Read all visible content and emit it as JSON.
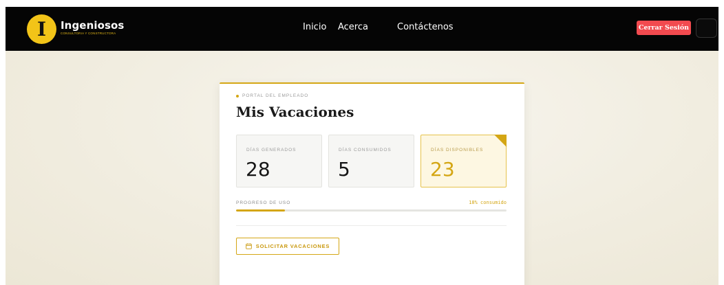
{
  "brand": {
    "name": "Ingeniosos",
    "subtitle": "CONSULTORIA Y CONSTRUCTORA",
    "logo_letter": "I",
    "accent_color": "#f2c418"
  },
  "nav": {
    "links": [
      {
        "label": "Inicio"
      },
      {
        "label": "Acerca"
      },
      {
        "label": "Contáctenos"
      }
    ],
    "logout_label": "Cerrar Sesión",
    "logout_color": "#f24a4f"
  },
  "portal": {
    "kicker": "PORTAL DEL EMPLEADO",
    "title": "Mis Vacaciones",
    "stats": [
      {
        "label": "DÍAS GENERADOS",
        "value": "28"
      },
      {
        "label": "DÍAS CONSUMIDOS",
        "value": "5"
      },
      {
        "label": "DÍAS DISPONIBLES",
        "value": "23"
      }
    ],
    "progress": {
      "label": "PROGRESO DE USO",
      "percent_text": "18% consumido",
      "fraction": 0.18
    },
    "request_button_label": "SOLICITAR VACACIONES",
    "request_icon": "calendar-icon",
    "gold_color": "#d4a614"
  }
}
